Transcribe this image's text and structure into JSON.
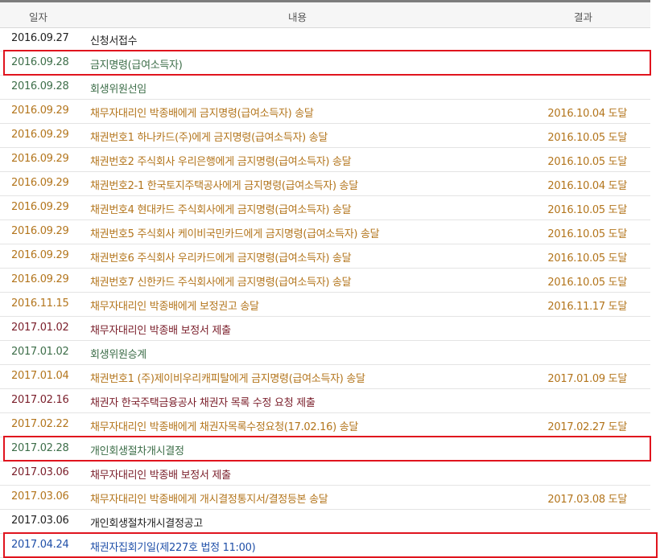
{
  "header": {
    "date": "일자",
    "content": "내용",
    "result": "결과"
  },
  "rows": [
    {
      "date": "2016.09.27",
      "content": "신청서접수",
      "result": ""
    },
    {
      "date": "2016.09.28",
      "content": "금지명령(급여소득자)",
      "result": ""
    },
    {
      "date": "2016.09.28",
      "content": "회생위원선임",
      "result": ""
    },
    {
      "date": "2016.09.29",
      "content": "채무자대리인 박종배에게 금지명령(급여소득자) 송달",
      "result": "2016.10.04 도달"
    },
    {
      "date": "2016.09.29",
      "content": "채권번호1 하나카드(주)에게 금지명령(급여소득자) 송달",
      "result": "2016.10.05 도달"
    },
    {
      "date": "2016.09.29",
      "content": "채권번호2 주식회사 우리은행에게 금지명령(급여소득자) 송달",
      "result": "2016.10.05 도달"
    },
    {
      "date": "2016.09.29",
      "content": "채권번호2-1 한국토지주택공사에게 금지명령(급여소득자) 송달",
      "result": "2016.10.04 도달"
    },
    {
      "date": "2016.09.29",
      "content": "채권번호4 현대카드 주식회사에게 금지명령(급여소득자) 송달",
      "result": "2016.10.05 도달"
    },
    {
      "date": "2016.09.29",
      "content": "채권번호5 주식회사 케이비국민카드에게 금지명령(급여소득자) 송달",
      "result": "2016.10.05 도달"
    },
    {
      "date": "2016.09.29",
      "content": "채권번호6 주식회사 우리카드에게 금지명령(급여소득자) 송달",
      "result": "2016.10.05 도달"
    },
    {
      "date": "2016.09.29",
      "content": "채권번호7 신한카드 주식회사에게 금지명령(급여소득자) 송달",
      "result": "2016.10.05 도달"
    },
    {
      "date": "2016.11.15",
      "content": "채무자대리인 박종배에게 보정권고 송달",
      "result": "2016.11.17 도달"
    },
    {
      "date": "2017.01.02",
      "content": "채무자대리인 박종배 보정서 제출",
      "result": ""
    },
    {
      "date": "2017.01.02",
      "content": "회생위원승계",
      "result": ""
    },
    {
      "date": "2017.01.04",
      "content": "채권번호1 (주)제이비우리캐피탈에게 금지명령(급여소득자) 송달",
      "result": "2017.01.09 도달"
    },
    {
      "date": "2017.02.16",
      "content": "채권자 한국주택금융공사 채권자 목록 수정 요청 제출",
      "result": ""
    },
    {
      "date": "2017.02.22",
      "content": "채무자대리인 박종배에게 채권자목록수정요청(17.02.16) 송달",
      "result": "2017.02.27 도달"
    },
    {
      "date": "2017.02.28",
      "content": "개인회생절차개시결정",
      "result": ""
    },
    {
      "date": "2017.03.06",
      "content": "채무자대리인 박종배 보정서 제출",
      "result": ""
    },
    {
      "date": "2017.03.06",
      "content": "채무자대리인 박종배에게 개시결정통지서/결정등본 송달",
      "result": "2017.03.08 도달"
    },
    {
      "date": "2017.03.06",
      "content": "개인회생절차개시결정공고",
      "result": ""
    },
    {
      "date": "2017.04.24",
      "content": "채권자집회기일(제227호 법정 11:00)",
      "result": ""
    }
  ],
  "colors": {
    "black": "#222222",
    "green": "#3d6e49",
    "orange": "#b3751c",
    "maroon": "#7a1e2a",
    "blue": "#1f4fa8",
    "highlight": "#e0141e"
  }
}
